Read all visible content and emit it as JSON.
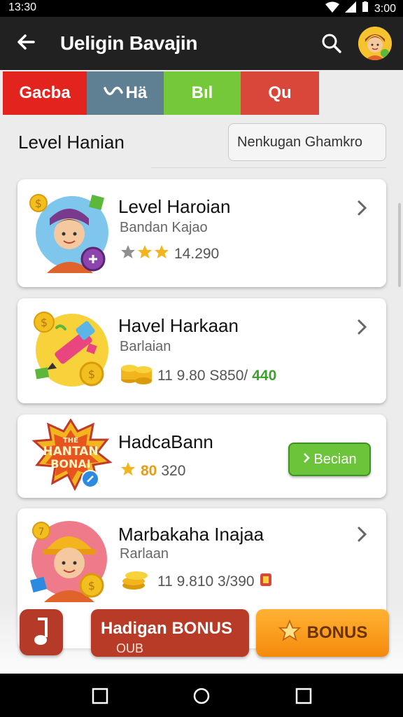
{
  "status_bar": {
    "time": "13:30",
    "right_time": "3:00"
  },
  "app_bar": {
    "title": "Ueligin Bavajin"
  },
  "tabs": [
    {
      "label": "Gacba"
    },
    {
      "label": "Hä"
    },
    {
      "label": "Bıl"
    },
    {
      "label": "Qu"
    }
  ],
  "section": {
    "title": "Level Hanian",
    "filter_value": "Nenkugan Ghamkro"
  },
  "cards": [
    {
      "name": "Level Haroian",
      "sub": "Bandan Kajao",
      "rating_value": "14.290"
    },
    {
      "name": "Havel Harkaan",
      "sub": "Barlaian",
      "amount": "11 9.80 S850/",
      "highlight": "440"
    },
    {
      "name": "HadcaBann",
      "stat_highlight": "80",
      "stat_rest": "320",
      "button": "Becian",
      "badge_text": "THE HANTAN BONAI"
    },
    {
      "name": "Marbakaha Inajaa",
      "sub": "Rarlaan",
      "amount": "11 9.810 3/390"
    }
  ],
  "bonus_bar": {
    "main_line1": "Hadigan BONUS",
    "main_line2": "OUB",
    "bonus_label": "BONUS"
  },
  "colors": {
    "tab_red": "#e3231d",
    "tab_slate": "#5f7f92",
    "tab_green": "#74c83a",
    "tab_coral": "#d9473a",
    "accent_orange": "#f58a0c"
  }
}
